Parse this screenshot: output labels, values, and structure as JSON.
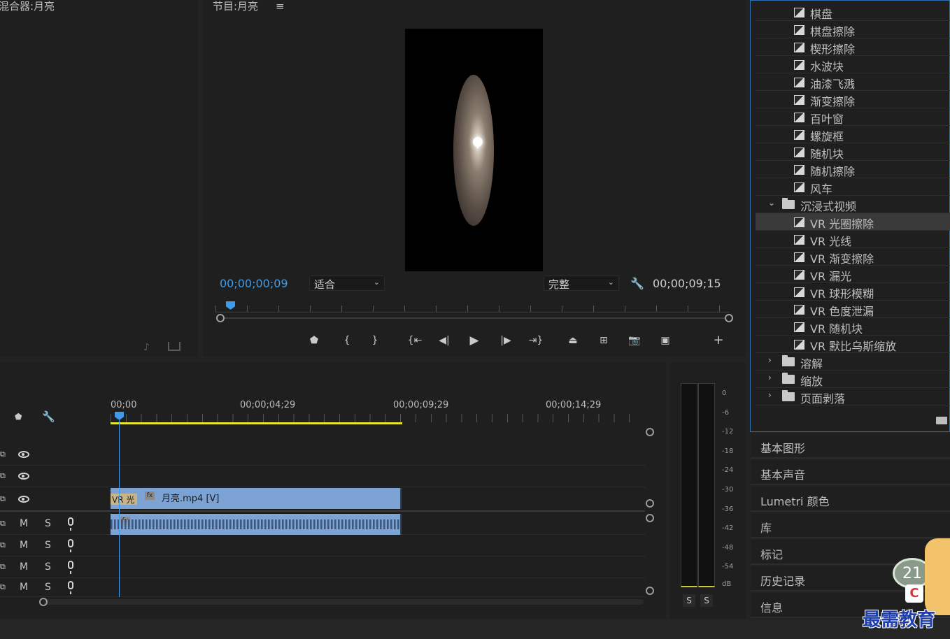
{
  "source_panel": {
    "title": "混合器:月亮"
  },
  "program_monitor": {
    "title": "节目:月亮",
    "menu_icon": "hamburger-icon",
    "current_timecode": "00;00;00;09",
    "zoom": "适合",
    "quality": "完整",
    "duration": "00;00;09;15",
    "playhead_fraction": 0.02
  },
  "transport": {
    "icons": [
      "marker-icon",
      "mark-in-icon",
      "mark-out-icon",
      "go-to-in-icon",
      "step-back-icon",
      "play-icon",
      "step-forward-icon",
      "go-to-out-icon",
      "lift-icon",
      "extract-icon",
      "camera-icon",
      "compare-icon",
      "add-icon"
    ]
  },
  "timeline": {
    "ruler": [
      "00;00",
      "00;00;04;29",
      "00;00;09;29",
      "00;00;14;29"
    ],
    "clip_video_name": "月亮.mp4 [V]",
    "clip_transition_label": "VR 光",
    "fx_label": "fx"
  },
  "track_labels": {
    "mute": "M",
    "solo": "S"
  },
  "meter": {
    "scale": [
      "0",
      "-6",
      "-12",
      "-18",
      "-24",
      "-30",
      "-36",
      "-42",
      "-48",
      "-54",
      "dB"
    ],
    "solo_buttons": [
      "S",
      "S"
    ]
  },
  "effects": {
    "items": [
      {
        "label": "棋盘",
        "type": "effect"
      },
      {
        "label": "棋盘擦除",
        "type": "effect"
      },
      {
        "label": "楔形擦除",
        "type": "effect"
      },
      {
        "label": "水波块",
        "type": "effect"
      },
      {
        "label": "油漆飞溅",
        "type": "effect"
      },
      {
        "label": "渐变擦除",
        "type": "effect"
      },
      {
        "label": "百叶窗",
        "type": "effect"
      },
      {
        "label": "螺旋框",
        "type": "effect"
      },
      {
        "label": "随机块",
        "type": "effect"
      },
      {
        "label": "随机擦除",
        "type": "effect"
      },
      {
        "label": "风车",
        "type": "effect"
      },
      {
        "label": "沉浸式视频",
        "type": "folder-open"
      },
      {
        "label": "VR 光圈擦除",
        "type": "effect",
        "selected": true
      },
      {
        "label": "VR 光线",
        "type": "effect"
      },
      {
        "label": "VR 渐变擦除",
        "type": "effect"
      },
      {
        "label": "VR 漏光",
        "type": "effect"
      },
      {
        "label": "VR 球形模糊",
        "type": "effect"
      },
      {
        "label": "VR 色度泄漏",
        "type": "effect"
      },
      {
        "label": "VR 随机块",
        "type": "effect"
      },
      {
        "label": "VR 默比乌斯缩放",
        "type": "effect"
      },
      {
        "label": "溶解",
        "type": "folder"
      },
      {
        "label": "缩放",
        "type": "folder"
      },
      {
        "label": "页面剥落",
        "type": "folder"
      }
    ]
  },
  "side_panels": [
    "基本图形",
    "基本声音",
    "Lumetri 颜色",
    "库",
    "标记",
    "历史记录",
    "信息"
  ],
  "watermark": {
    "text": "最需教育",
    "badge": "21",
    "letter": "C"
  }
}
